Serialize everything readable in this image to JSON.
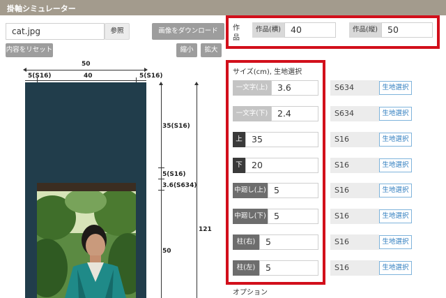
{
  "app_title": "掛軸シミュレーター",
  "file": {
    "name": "cat.jpg",
    "browse_label": "参照"
  },
  "buttons": {
    "download": "画像をダウンロード",
    "reset": "内容をリセット",
    "zoom_out": "縮小",
    "zoom_in": "拡大"
  },
  "dimensions": {
    "total_width": "50",
    "left_margin": "5(S16)",
    "inner_width": "40",
    "right_margin": "5(S16)",
    "top_section": "35(S16)",
    "ichimonji_top": "5(S16)",
    "ichimonji_bottom": "3.6(S634)",
    "lower": "50",
    "total_height": "121"
  },
  "work": {
    "label": "作品",
    "width_label": "作品(横)",
    "width_value": "40",
    "height_label": "作品(縦)",
    "height_value": "50"
  },
  "sizes_heading": "サイズ(cm), 生地選択",
  "sizes": [
    {
      "label": "一文字(上)",
      "value": "3.6",
      "fabric": "S634",
      "button": "生地選択"
    },
    {
      "label": "一文字(下)",
      "value": "2.4",
      "fabric": "S634",
      "button": "生地選択"
    },
    {
      "label": "上",
      "value": "35",
      "fabric": "S16",
      "button": "生地選択"
    },
    {
      "label": "下",
      "value": "20",
      "fabric": "S16",
      "button": "生地選択"
    },
    {
      "label": "中廻し(上)",
      "value": "5",
      "fabric": "S16",
      "button": "生地選択"
    },
    {
      "label": "中廻し(下)",
      "value": "5",
      "fabric": "S16",
      "button": "生地選択"
    },
    {
      "label": "柱(右)",
      "value": "5",
      "fabric": "S16",
      "button": "生地選択"
    },
    {
      "label": "柱(左)",
      "value": "5",
      "fabric": "S16",
      "button": "生地選択"
    }
  ],
  "options_heading": "オプション",
  "colors": {
    "accent_red": "#d20f1b",
    "fabric_blue": "#213d4b",
    "title_bar": "#a39b8d"
  }
}
